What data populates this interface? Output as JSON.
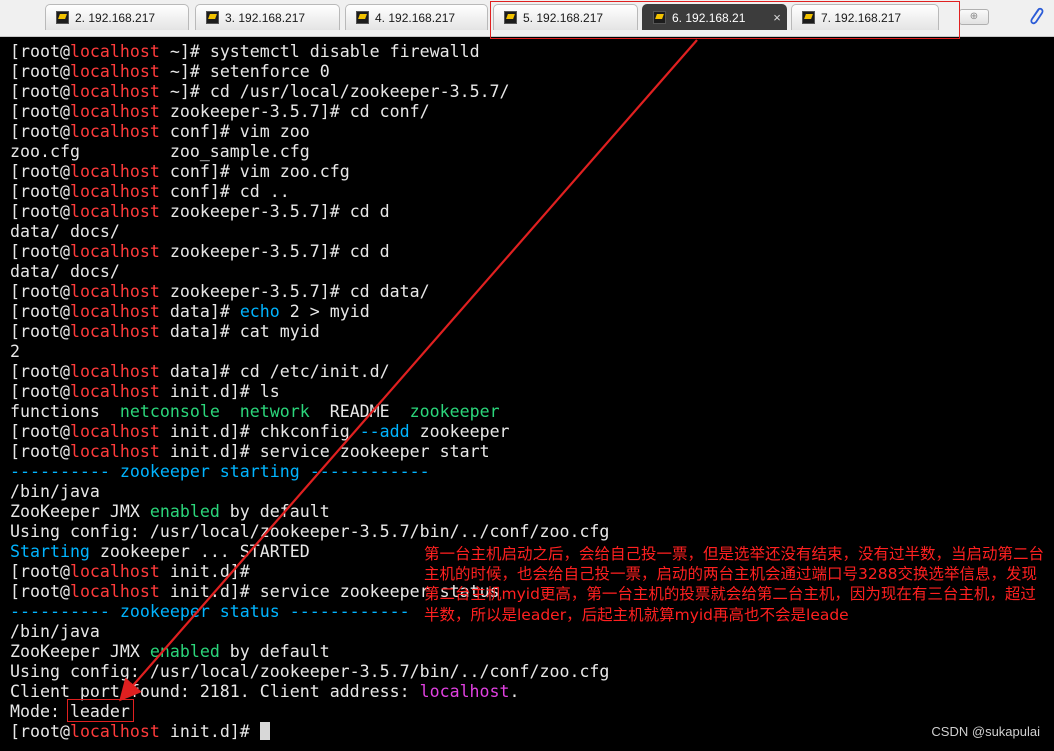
{
  "tabs": [
    {
      "label": "2. 192.168.217",
      "active": false
    },
    {
      "label": "3. 192.168.217",
      "active": false
    },
    {
      "label": "4. 192.168.217",
      "active": false
    },
    {
      "label": "5. 192.168.217",
      "active": false
    },
    {
      "label": "6. 192.168.21",
      "active": true
    },
    {
      "label": "7. 192.168.217",
      "active": false
    }
  ],
  "icons": {
    "tab": "putty-terminal-icon",
    "close": "×",
    "new_tab": "plus-icon",
    "attach": "paperclip-icon"
  },
  "terminal": {
    "lines": [
      [
        [
          "[root@",
          "w"
        ],
        [
          "localhost",
          "r"
        ],
        [
          " ~]# systemctl disable firewalld",
          "w"
        ]
      ],
      [
        [
          "[root@",
          "w"
        ],
        [
          "localhost",
          "r"
        ],
        [
          " ~]# setenforce 0",
          "w"
        ]
      ],
      [
        [
          "[root@",
          "w"
        ],
        [
          "localhost",
          "r"
        ],
        [
          " ~]# cd /usr/local/zookeeper-3.5.7/",
          "w"
        ]
      ],
      [
        [
          "[root@",
          "w"
        ],
        [
          "localhost",
          "r"
        ],
        [
          " zookeeper-3.5.7]# cd conf/",
          "w"
        ]
      ],
      [
        [
          "[root@",
          "w"
        ],
        [
          "localhost",
          "r"
        ],
        [
          " conf]# vim zoo",
          "w"
        ]
      ],
      [
        [
          "zoo.cfg         zoo_sample.cfg",
          "w"
        ]
      ],
      [
        [
          "[root@",
          "w"
        ],
        [
          "localhost",
          "r"
        ],
        [
          " conf]# vim zoo.cfg",
          "w"
        ]
      ],
      [
        [
          "[root@",
          "w"
        ],
        [
          "localhost",
          "r"
        ],
        [
          " conf]# cd ..",
          "w"
        ]
      ],
      [
        [
          "[root@",
          "w"
        ],
        [
          "localhost",
          "r"
        ],
        [
          " zookeeper-3.5.7]# cd d",
          "w"
        ]
      ],
      [
        [
          "data/ docs/",
          "w"
        ]
      ],
      [
        [
          "[root@",
          "w"
        ],
        [
          "localhost",
          "r"
        ],
        [
          " zookeeper-3.5.7]# cd d",
          "w"
        ]
      ],
      [
        [
          "data/ docs/",
          "w"
        ]
      ],
      [
        [
          "[root@",
          "w"
        ],
        [
          "localhost",
          "r"
        ],
        [
          " zookeeper-3.5.7]# cd data/",
          "w"
        ]
      ],
      [
        [
          "[root@",
          "w"
        ],
        [
          "localhost",
          "r"
        ],
        [
          " data]# ",
          "w"
        ],
        [
          "echo",
          "c"
        ],
        [
          " 2 > myid",
          "w"
        ]
      ],
      [
        [
          "[root@",
          "w"
        ],
        [
          "localhost",
          "r"
        ],
        [
          " data]# cat myid",
          "w"
        ]
      ],
      [
        [
          "2",
          "w"
        ]
      ],
      [
        [
          "[root@",
          "w"
        ],
        [
          "localhost",
          "r"
        ],
        [
          " data]# cd /etc/init.d/",
          "w"
        ]
      ],
      [
        [
          "[root@",
          "w"
        ],
        [
          "localhost",
          "r"
        ],
        [
          " init.d]# ls",
          "w"
        ]
      ],
      [
        [
          "functions  ",
          "w"
        ],
        [
          "netconsole",
          "g"
        ],
        [
          "  ",
          "w"
        ],
        [
          "network",
          "g"
        ],
        [
          "  README  ",
          "w"
        ],
        [
          "zookeeper",
          "g"
        ]
      ],
      [
        [
          "[root@",
          "w"
        ],
        [
          "localhost",
          "r"
        ],
        [
          " init.d]# chkconfig ",
          "w"
        ],
        [
          "--add",
          "c"
        ],
        [
          " zookeeper",
          "w"
        ]
      ],
      [
        [
          "[root@",
          "w"
        ],
        [
          "localhost",
          "r"
        ],
        [
          " init.d]# service zookeeper start",
          "w"
        ]
      ],
      [
        [
          "---------- zookeeper ",
          "c"
        ],
        [
          "starting",
          "c"
        ],
        [
          " ------------",
          "c"
        ]
      ],
      [
        [
          "/bin/java",
          "w"
        ]
      ],
      [
        [
          "ZooKeeper JMX ",
          "w"
        ],
        [
          "enabled",
          "g"
        ],
        [
          " by default",
          "w"
        ]
      ],
      [
        [
          "Using config: /usr/local/zookeeper-3.5.7/bin/../conf/zoo.cfg",
          "w"
        ]
      ],
      [
        [
          "Starting",
          "c"
        ],
        [
          " zookeeper ... STARTED",
          "w"
        ]
      ],
      [
        [
          "[root@",
          "w"
        ],
        [
          "localhost",
          "r"
        ],
        [
          " init.d]#",
          "w"
        ]
      ],
      [
        [
          "[root@",
          "w"
        ],
        [
          "localhost",
          "r"
        ],
        [
          " init.d]# service zookeeper status",
          "w"
        ]
      ],
      [
        [
          "---------- zookeeper status ------------",
          "c"
        ]
      ],
      [
        [
          "/bin/java",
          "w"
        ]
      ],
      [
        [
          "ZooKeeper JMX ",
          "w"
        ],
        [
          "enabled",
          "g"
        ],
        [
          " by default",
          "w"
        ]
      ],
      [
        [
          "Using config: /usr/local/zookeeper-3.5.7/bin/../conf/zoo.cfg",
          "w"
        ]
      ],
      [
        [
          "Client port found: 2181. Client address: ",
          "w"
        ],
        [
          "localhost",
          "m"
        ],
        [
          ".",
          "w"
        ]
      ],
      [
        [
          "Mode: leader",
          "w"
        ]
      ],
      [
        [
          "[root@",
          "w"
        ],
        [
          "localhost",
          "r"
        ],
        [
          " init.d]# ",
          "w"
        ]
      ]
    ],
    "colors": {
      "w": "#e8e8e8",
      "r": "#ff3b3b",
      "c": "#00b4ff",
      "g": "#2bd67b",
      "m": "#e040e0"
    }
  },
  "annotation": {
    "text": "第一台主机启动之后，会给自己投一票，但是选举还没有结束，没有过半数，当启动第二台主机的时候，也会给自己投一票，启动的两台主机会通过端口号3288交换选举信息，发现第二台主机myid更高，第一台主机的投票就会给第二台主机，因为现在有三台主机，超过半数，所以是leader，后起主机就算myid再高也不会是leade",
    "color": "#ff2020"
  },
  "watermark": "CSDN @sukapulai"
}
